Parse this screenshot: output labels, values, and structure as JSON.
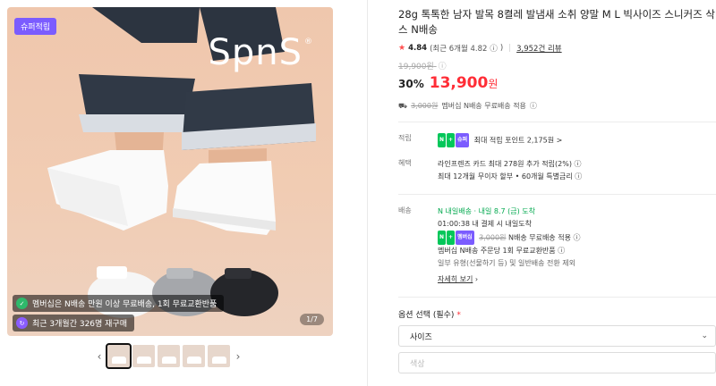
{
  "gallery": {
    "badge": "슈퍼적립",
    "brand": "SpnS",
    "brand_mark": "®",
    "counter": "1/7",
    "promos": [
      {
        "icon": "green-check-icon",
        "text": "멤버십은 N배송 만원 이상 무료배송, 1회 무료교환반품"
      },
      {
        "icon": "purple-repeat-icon",
        "text": "최근 3개월간 326명 재구매"
      }
    ],
    "thumb_count": 5,
    "prev_label": "‹",
    "next_label": "›"
  },
  "product": {
    "title": "28g 톡톡한 남자 발목 8켤레 발냄새 소취 양말 M L 빅사이즈 스니커즈 삭스 N배송",
    "rating": "4.84",
    "rating_recent": "(최근 6개월 4.82",
    "rating_recent_close": ")",
    "review_count": "3,952건 리뷰",
    "original_price": "19,900원",
    "discount": "30%",
    "sale_price": "13,900",
    "sale_unit": "원",
    "ship_old": "3,000원",
    "ship_text": "멤버십 N배송 무료배송 적용"
  },
  "rewards": {
    "label": "적립",
    "text": "최대 적립 포인트 2,175원",
    "arrow": ">"
  },
  "benefits": {
    "label": "혜택",
    "line1": "라인프렌즈 카드 최대 278원 추가 적립(2%)",
    "line2": "최대 12개월 무이자 할부 • 60개월 특별금리"
  },
  "shipping": {
    "label": "배송",
    "badge": "N 내일배송",
    "date": "· 내일 8.7 (금) 도착",
    "countdown": "01:00:38  내 결제 시 내일도착",
    "fee_old": "3,000원",
    "fee_text": "N배송 무료배송 적용",
    "exchange": "멤버십 N배송 주문당 1회 무료교환반품",
    "note": "일부 유형(선물하기 등) 및 일반배송 전환 제외",
    "more": "자세히 보기"
  },
  "options": {
    "label": "옵션 선택 (필수)",
    "required_mark": "*",
    "size_placeholder": "사이즈",
    "color_placeholder": "색상"
  }
}
